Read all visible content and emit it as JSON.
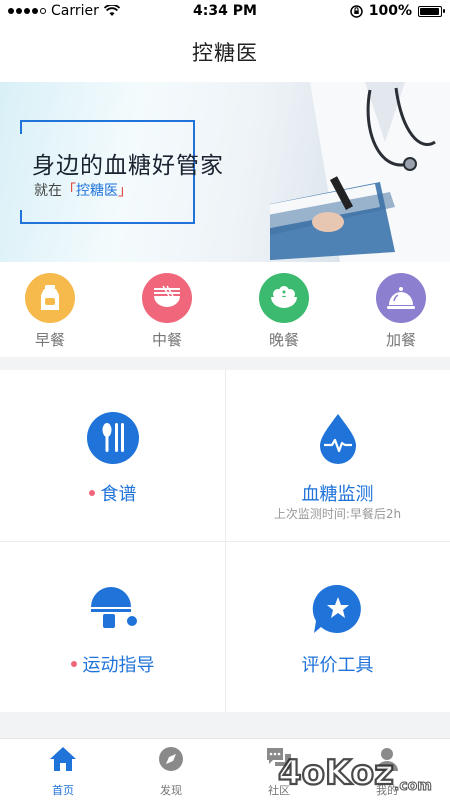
{
  "status_bar": {
    "carrier": "Carrier",
    "time": "4:34 PM",
    "battery_percent_text": "100%",
    "battery_level": 1.0
  },
  "nav": {
    "title": "控糖医"
  },
  "banner": {
    "headline": "身边的血糖好管家",
    "sub_prefix": "就在",
    "sub_bracket_open": "「",
    "sub_brand": "控糖医",
    "sub_bracket_close": "」"
  },
  "meals": [
    {
      "label": "早餐",
      "icon": "milk-bottle-icon",
      "color": "#f6b94b"
    },
    {
      "label": "中餐",
      "icon": "noodle-bowl-icon",
      "color": "#f0677b"
    },
    {
      "label": "晚餐",
      "icon": "rice-bowl-icon",
      "color": "#3cba6f"
    },
    {
      "label": "加餐",
      "icon": "food-cloche-icon",
      "color": "#8d7fd0"
    }
  ],
  "features": [
    {
      "label": "食谱",
      "icon": "spoon-fork-icon",
      "has_dot": true
    },
    {
      "label": "血糖监测",
      "icon": "blood-drop-pulse-icon",
      "sub": "上次监测时间:早餐后2h",
      "has_dot": false
    },
    {
      "label": "运动指导",
      "icon": "table-tennis-icon",
      "has_dot": true
    },
    {
      "label": "评价工具",
      "icon": "star-bubble-icon",
      "has_dot": false
    }
  ],
  "tabs": [
    {
      "label": "首页",
      "icon": "home-icon",
      "active": true
    },
    {
      "label": "发现",
      "icon": "compass-icon",
      "active": false
    },
    {
      "label": "社区",
      "icon": "chat-bubbles-icon",
      "active": false
    },
    {
      "label": "我的",
      "icon": "user-icon",
      "active": false
    }
  ],
  "watermark": {
    "text": "4oKoz",
    "suffix": ".com"
  },
  "colors": {
    "primary": "#1f73d9",
    "dot": "#f0677b",
    "background": "#f2f3f5"
  }
}
